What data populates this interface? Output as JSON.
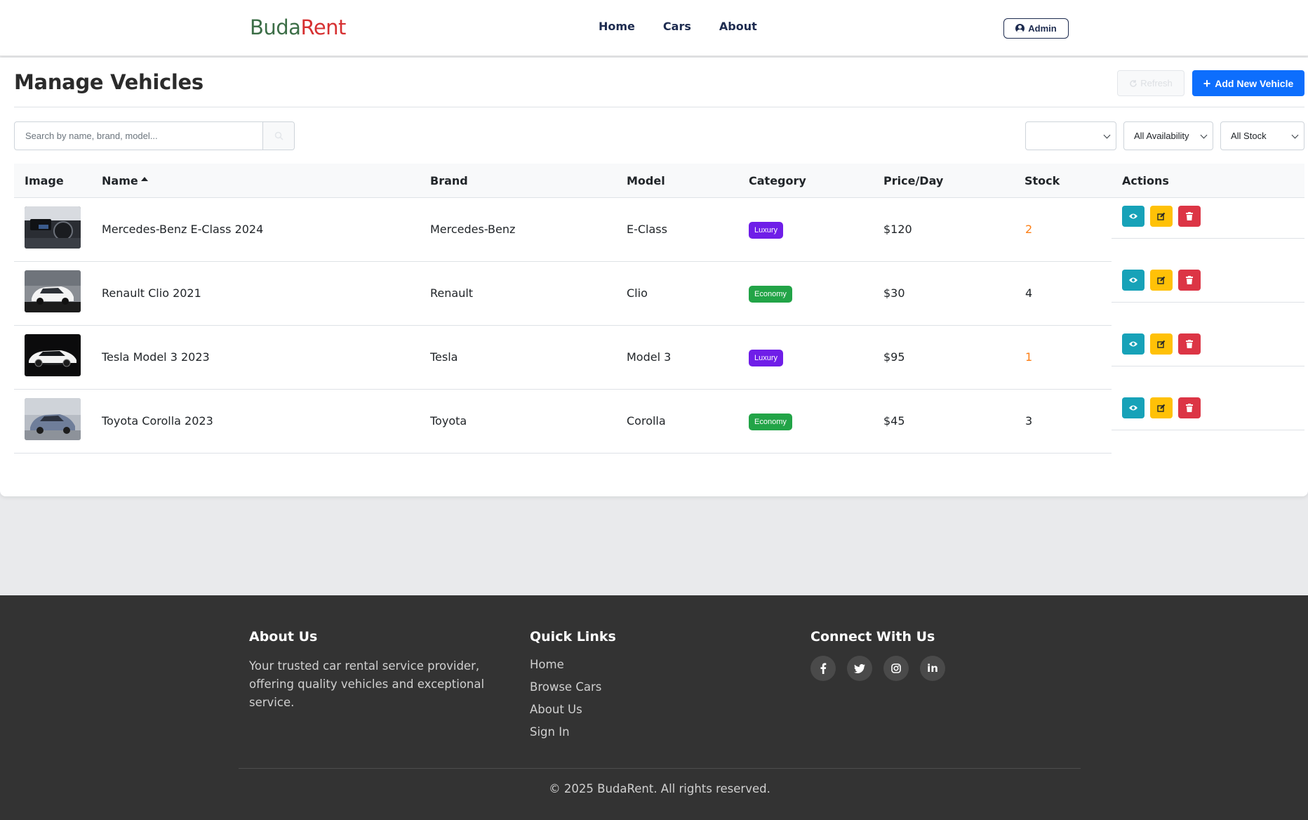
{
  "navbar": {
    "brand_part1": "Buda",
    "brand_part2": "Rent",
    "links": [
      "Home",
      "Cars",
      "About"
    ],
    "admin_label": "Admin"
  },
  "page": {
    "title": "Manage Vehicles",
    "refresh_label": "Refresh",
    "add_label": "Add New Vehicle",
    "search_placeholder": "Search by name, brand, model...",
    "filters": {
      "category_selected": "",
      "availability_selected": "All Availability",
      "stock_selected": "All Stock"
    }
  },
  "table": {
    "headers": [
      "Image",
      "Name",
      "Brand",
      "Model",
      "Category",
      "Price/Day",
      "Stock",
      "Actions"
    ],
    "sorted_column": "Name",
    "sort_direction": "ascending",
    "rows": [
      {
        "name": "Mercedes-Benz E-Class 2024",
        "brand": "Mercedes-Benz",
        "model": "E-Class",
        "category": "Luxury",
        "price": "$120",
        "stock": "2",
        "low_stock": true,
        "image_icon": "car-interior-photo"
      },
      {
        "name": "Renault Clio 2021",
        "brand": "Renault",
        "model": "Clio",
        "category": "Economy",
        "price": "$30",
        "stock": "4",
        "low_stock": false,
        "image_icon": "white-hatchback-photo"
      },
      {
        "name": "Tesla Model 3 2023",
        "brand": "Tesla",
        "model": "Model 3",
        "category": "Luxury",
        "price": "$95",
        "stock": "1",
        "low_stock": true,
        "image_icon": "white-sedan-dark-studio-photo"
      },
      {
        "name": "Toyota Corolla 2023",
        "brand": "Toyota",
        "model": "Corolla",
        "category": "Economy",
        "price": "$45",
        "stock": "3",
        "low_stock": false,
        "image_icon": "blue-grey-hatchback-photo"
      }
    ]
  },
  "colors": {
    "brand_green": "#3c6e47",
    "brand_red": "#d63031",
    "luxury_badge": "#6f1ee8",
    "economy_badge": "#22a447",
    "low_stock": "#fd7e14",
    "primary_button": "#0d6efd",
    "view_button": "#17a2b8",
    "edit_button": "#ffc107",
    "delete_button": "#dc3545",
    "footer_bg": "#333333"
  },
  "footer": {
    "about_title": "About Us",
    "about_text": "Your trusted car rental service provider, offering quality vehicles and exceptional service.",
    "links_title": "Quick Links",
    "links": [
      "Home",
      "Browse Cars",
      "About Us",
      "Sign In"
    ],
    "connect_title": "Connect With Us",
    "social_icons": [
      "facebook-icon",
      "twitter-icon",
      "instagram-icon",
      "linkedin-icon"
    ],
    "copyright": "© 2025 BudaRent. All rights reserved."
  }
}
